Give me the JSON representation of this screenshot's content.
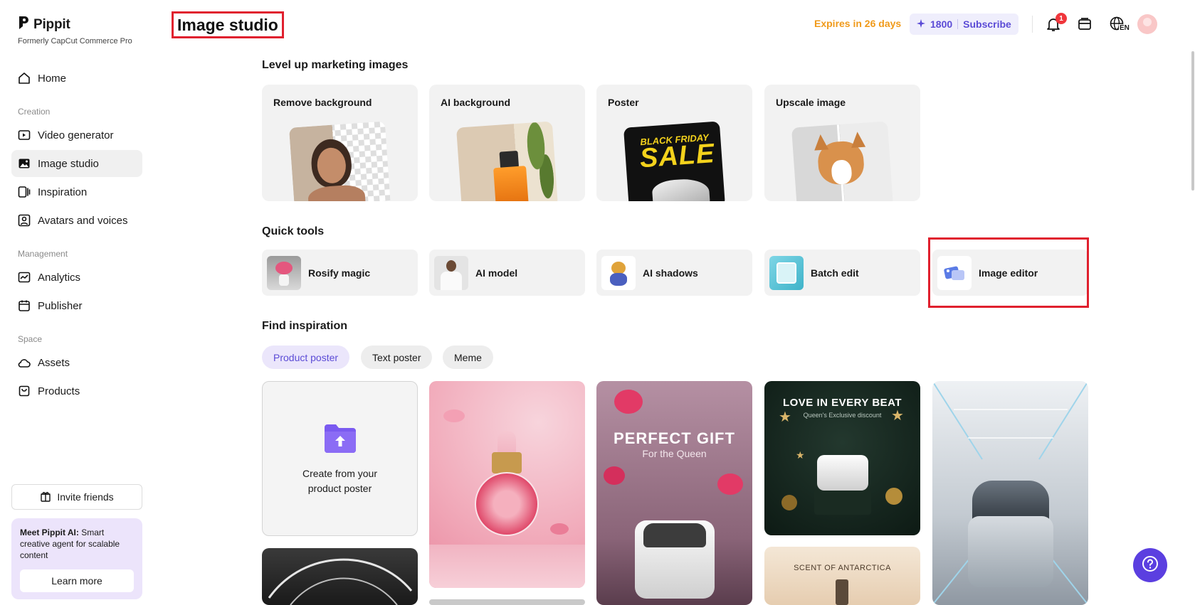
{
  "brand": {
    "name": "Pippit",
    "subtitle": "Formerly CapCut Commerce Pro"
  },
  "sidebar": {
    "home": "Home",
    "creation_label": "Creation",
    "creation_items": [
      "Video generator",
      "Image studio",
      "Inspiration",
      "Avatars and voices"
    ],
    "management_label": "Management",
    "management_items": [
      "Analytics",
      "Publisher"
    ],
    "space_label": "Space",
    "space_items": [
      "Assets",
      "Products"
    ],
    "invite": "Invite friends",
    "promo_bold": "Meet Pippit AI:",
    "promo_text": " Smart creative agent for scalable content",
    "learn_more": "Learn more"
  },
  "header": {
    "title": "Image studio",
    "expires": "Expires in 26 days",
    "credits": "1800",
    "subscribe": "Subscribe",
    "notification_count": "1",
    "lang": "EN"
  },
  "level_up": {
    "title": "Level up marketing images",
    "cards": [
      "Remove background",
      "AI background",
      "Poster",
      "Upscale image"
    ],
    "poster_text_top": "BLACK FRIDAY",
    "poster_text_main": "SALE"
  },
  "quick_tools": {
    "title": "Quick tools",
    "items": [
      "Rosify magic",
      "AI model",
      "AI shadows",
      "Batch edit",
      "Image editor"
    ]
  },
  "inspiration": {
    "title": "Find inspiration",
    "chips": [
      "Product poster",
      "Text poster",
      "Meme"
    ],
    "create_text": "Create from your product poster",
    "card_gift_title": "PERFECT GIFT",
    "card_gift_sub": "For the Queen",
    "card_love_title": "LOVE IN EVERY BEAT",
    "card_love_sub": "Queen's Exclusive discount",
    "card_scent_title": "SCENT OF ANTARCTICA"
  },
  "colors": {
    "accent": "#5b3fe0",
    "highlight_box": "#e0202e",
    "expires": "#f09a1a"
  }
}
